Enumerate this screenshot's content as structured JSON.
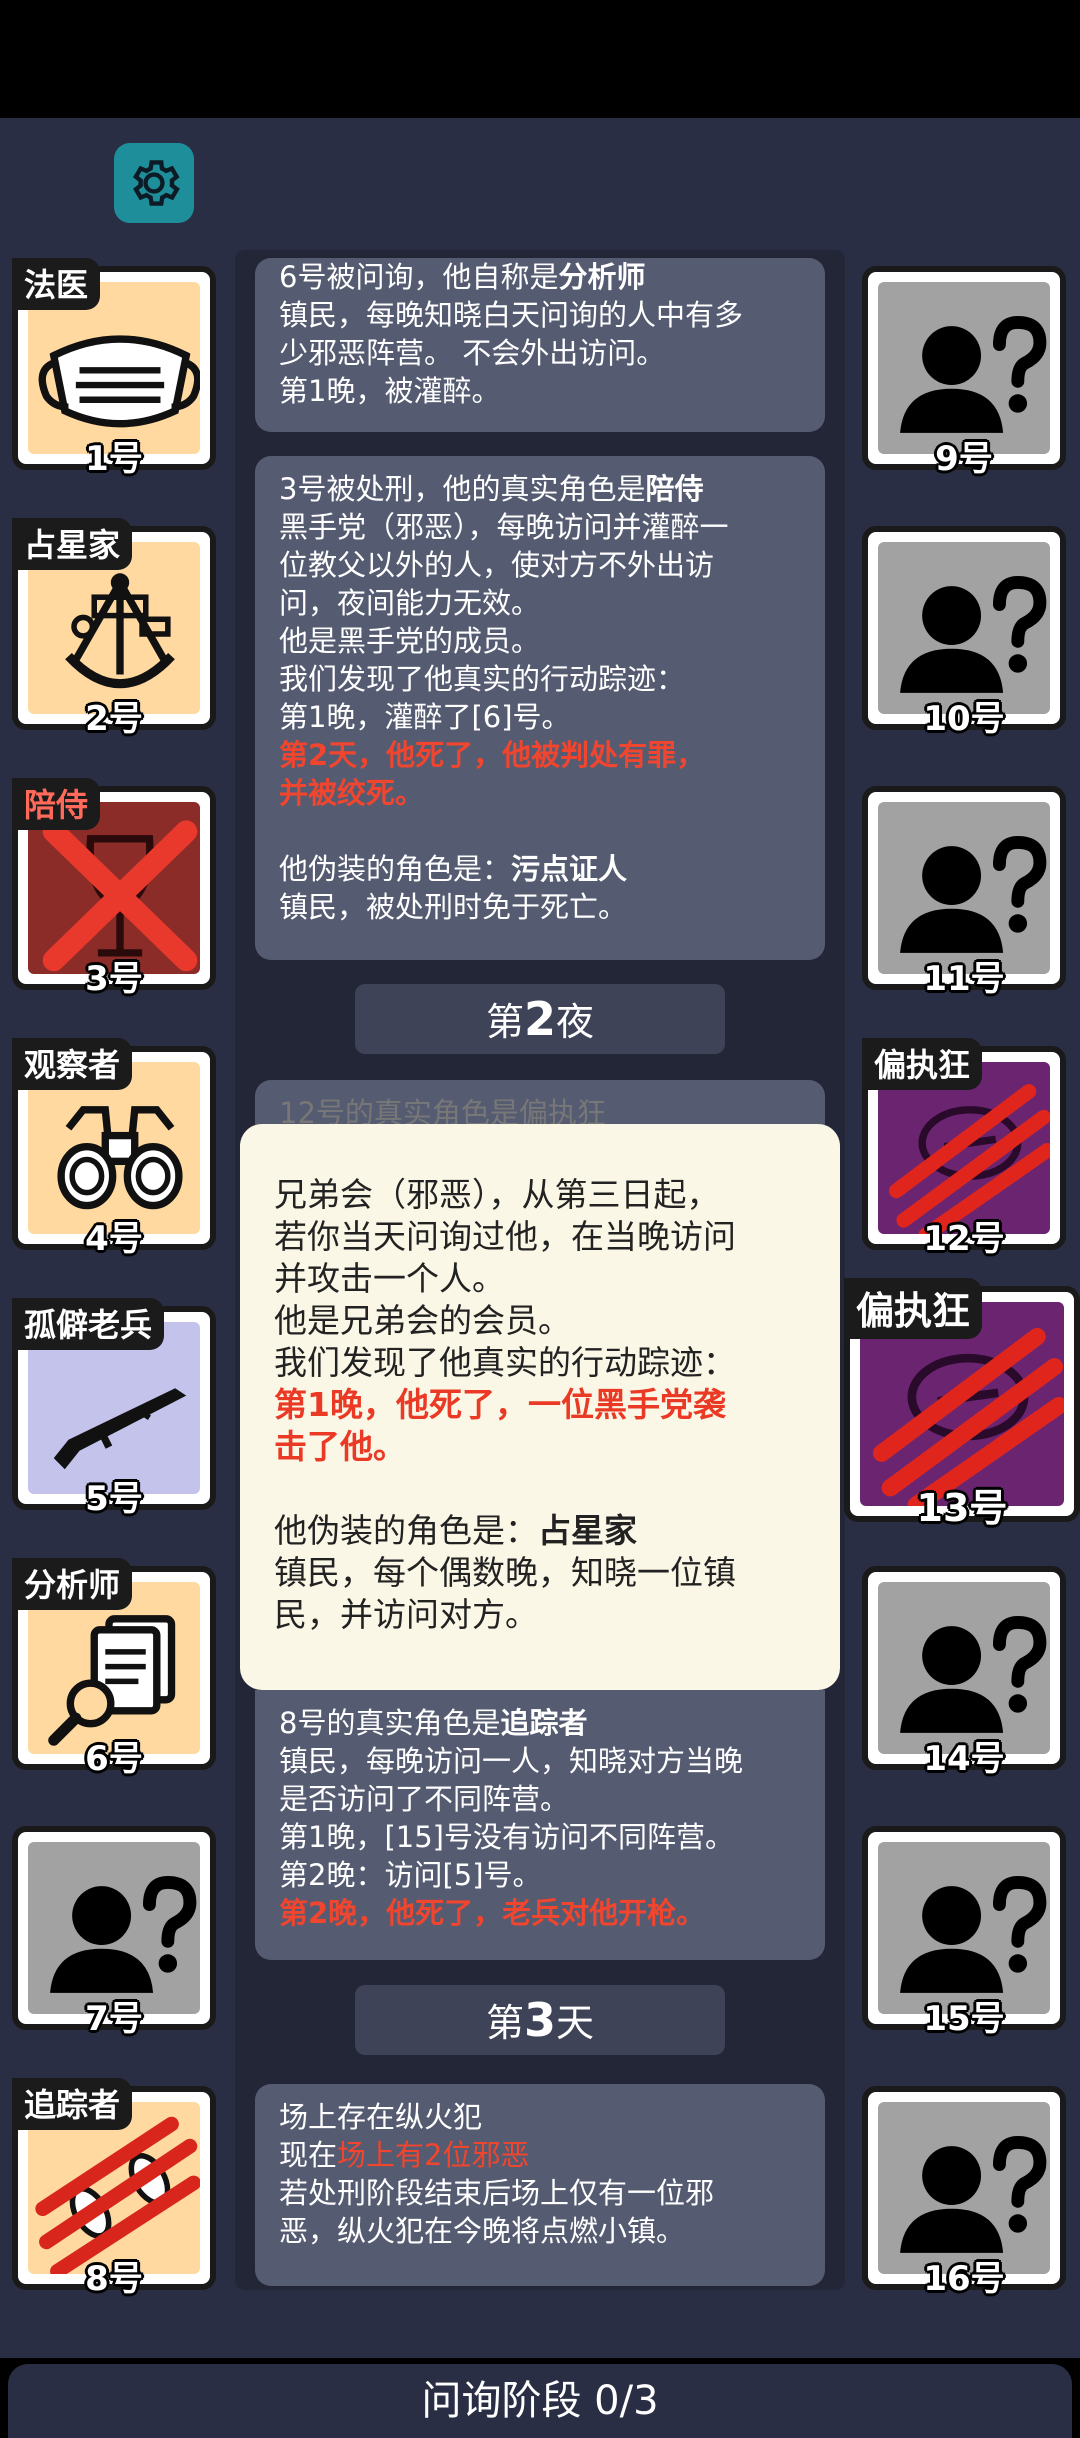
{
  "settings_icon": "gear-icon",
  "left_players": [
    {
      "num": "1号",
      "role": "法医",
      "icon": "mask-icon"
    },
    {
      "num": "2号",
      "role": "占星家",
      "icon": "sextant-icon"
    },
    {
      "num": "3号",
      "role": "陪侍",
      "icon": "wine-glass-icon",
      "state": "dead"
    },
    {
      "num": "4号",
      "role": "观察者",
      "icon": "binoculars-icon"
    },
    {
      "num": "5号",
      "role": "孤僻老兵",
      "icon": "rifle-icon"
    },
    {
      "num": "6号",
      "role": "分析师",
      "icon": "documents-magnifier-icon"
    },
    {
      "num": "7号",
      "role": "",
      "icon": "unknown-person-icon"
    },
    {
      "num": "8号",
      "role": "追踪者",
      "icon": "footprints-icon",
      "state": "attacked"
    }
  ],
  "right_players": [
    {
      "num": "9号",
      "icon": "unknown-person-icon"
    },
    {
      "num": "10号",
      "icon": "unknown-person-icon"
    },
    {
      "num": "11号",
      "icon": "unknown-person-icon"
    },
    {
      "num": "12号",
      "role": "偏执狂",
      "icon": "paranoid-icon",
      "state": "attacked"
    },
    {
      "num": "13号",
      "role": "偏执狂",
      "icon": "paranoid-icon",
      "state": "attacked"
    },
    {
      "num": "14号",
      "icon": "unknown-person-icon"
    },
    {
      "num": "15号",
      "icon": "unknown-person-icon"
    },
    {
      "num": "16号",
      "icon": "unknown-person-icon"
    }
  ],
  "log": {
    "entry1": {
      "line1_pre": "6号被问询，他自称是",
      "line1_role": "分析师",
      "lines": [
        "镇民，每晚知晓白天问询的人中有多",
        "少邪恶阵营。 不会外出访问。",
        "第1晚，被灌醉。"
      ]
    },
    "entry2": {
      "line1_pre": "3号被处刑，他的真实角色是",
      "line1_role": "陪侍",
      "lines": [
        "黑手党（邪恶），每晚访问并灌醉一",
        "位教父以外的人，使对方不外出访",
        "问，夜间能力无效。",
        "他是黑手党的成员。",
        "我们发现了他真实的行动踪迹：",
        "第1晚，灌醉了[6]号。"
      ],
      "red_lines": [
        "第2天，他死了，他被判处有罪，",
        "并被绞死。"
      ],
      "fake_pre": "他伪装的角色是：",
      "fake_role": "污点证人",
      "fake_desc": "镇民，被处刑时免于死亡。"
    },
    "night2_prefix": "第",
    "night2_num": "2",
    "night2_suffix": "夜",
    "entry3_peek": "12号的真实角色是偏执狂",
    "entry4": {
      "line1_pre": "8号的真实角色是",
      "line1_role": "追踪者",
      "lines": [
        "镇民，每晚访问一人，知晓对方当晚",
        "是否访问了不同阵营。",
        "第1晚，[15]号没有访问不同阵营。",
        "第2晚：访问[5]号。"
      ],
      "red_line": "第2晚，他死了，老兵对他开枪。"
    },
    "day3_prefix": "第",
    "day3_num": "3",
    "day3_suffix": "天",
    "entry5": {
      "line1": "场上存在纵火犯",
      "line2_pre": "现在",
      "line2_red": "场上有2位邪恶",
      "lines": [
        "若处刑阶段结束后场上仅有一位邪",
        "恶，纵火犯在今晚将点燃小镇。"
      ]
    }
  },
  "popup": {
    "lines": [
      "兄弟会（邪恶），从第三日起，",
      "若你当天问询过他，在当晚访问",
      "并攻击一个人。",
      "他是兄弟会的会员。",
      "我们发现了他真实的行动踪迹："
    ],
    "red_lines": [
      "第1晚，他死了，一位黑手党袭",
      "击了他。"
    ],
    "fake_pre": "他伪装的角色是：",
    "fake_role": "占星家",
    "fake_lines": [
      "镇民，每个偶数晚，知晓一位镇",
      "民，并访问对方。"
    ]
  },
  "phase_label": "问询阶段 0/3"
}
